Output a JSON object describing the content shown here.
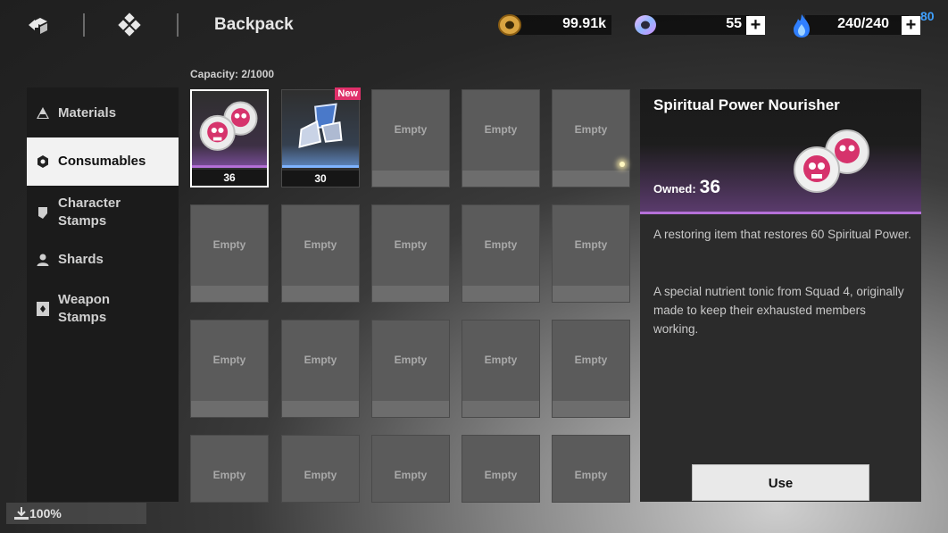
{
  "header": {
    "title": "Backpack",
    "nav_icons": [
      "back-cube-icon",
      "menu-diamond-icon"
    ]
  },
  "currencies": [
    {
      "name": "coin",
      "icon": "gold-coin-icon",
      "value": "99.91k"
    },
    {
      "name": "gem",
      "icon": "gem-ring-icon",
      "value": "55"
    },
    {
      "name": "energy",
      "icon": "blue-flame-icon",
      "value": "240/240",
      "extra": "80"
    }
  ],
  "sidebar": {
    "items": [
      {
        "label": "Materials",
        "icon": "flask-icon",
        "active": false
      },
      {
        "label": "Consumables",
        "icon": "hexagon-icon",
        "active": true
      },
      {
        "label": "Character\nStamps",
        "icon": "stamp-icon",
        "active": false
      },
      {
        "label": "Shards",
        "icon": "person-icon",
        "active": false
      },
      {
        "label": "Weapon\nStamps",
        "icon": "card-icon",
        "active": false
      }
    ],
    "storage": "100%"
  },
  "inventory": {
    "capacity": "Capacity: 2/1000",
    "items": [
      {
        "count": "36",
        "selected": true,
        "art": "pink-skull-tablets"
      },
      {
        "count": "30",
        "new": "New",
        "art": "blue-crystal-shards"
      }
    ],
    "empty_label": "Empty"
  },
  "detail": {
    "title": "Spiritual Power Nourisher",
    "owned_label": "Owned:",
    "owned_value": "36",
    "description": "A restoring item that restores 60 Spiritual Power.",
    "lore": "A special nutrient tonic from Squad 4, originally made to keep their exhausted members working.",
    "use_label": "Use"
  },
  "colors": {
    "rarity_purple": "#b570d8",
    "rarity_blue": "#7fb4ff",
    "new_badge": "#e0306a",
    "energy_blue": "#3fa0ff"
  }
}
